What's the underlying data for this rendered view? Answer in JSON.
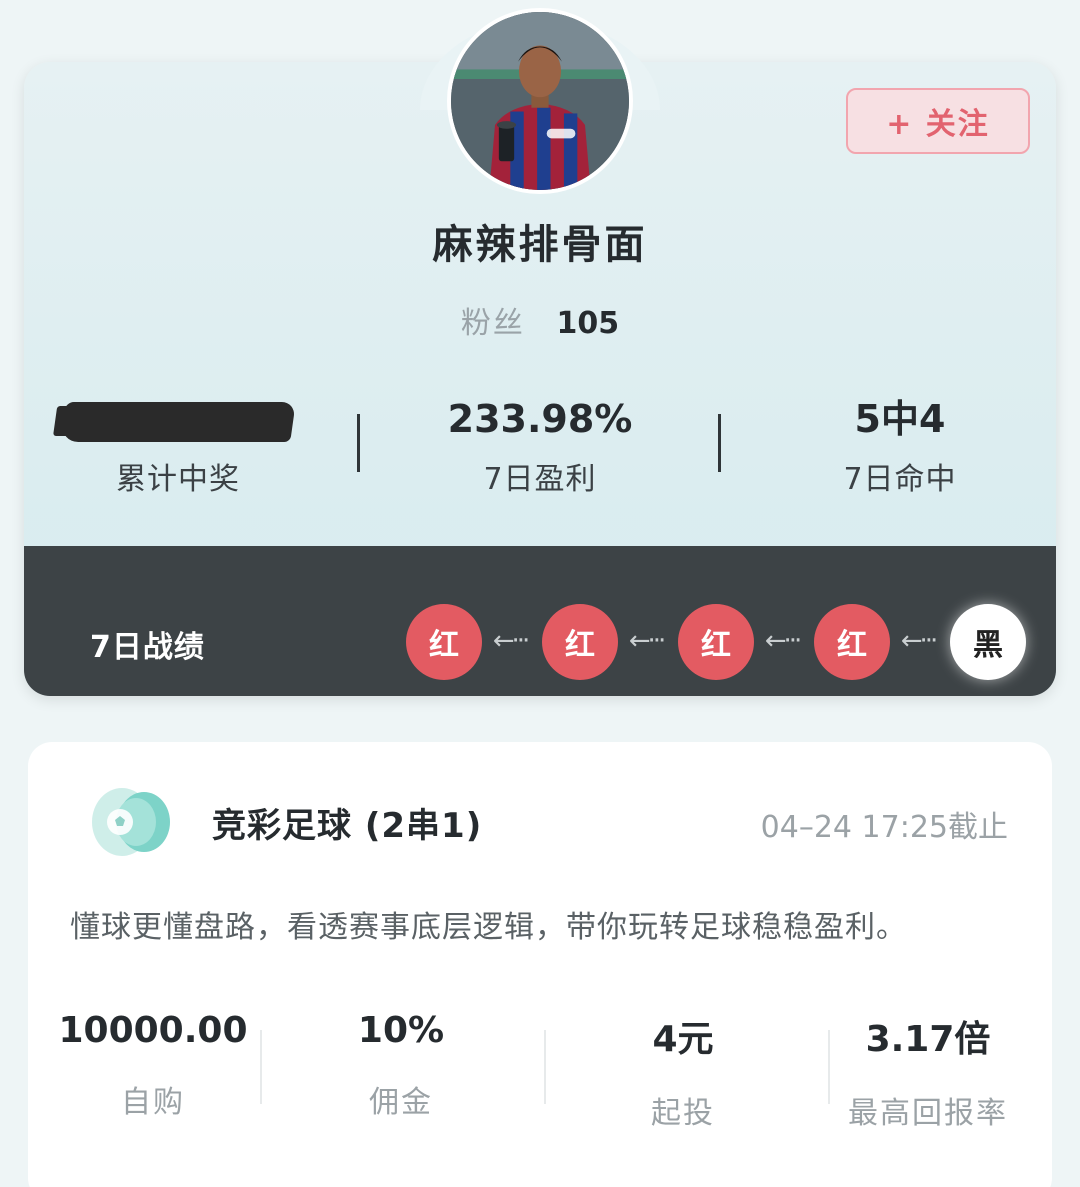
{
  "profile": {
    "name": "麻辣排骨面",
    "follow_label": "+ 关注",
    "fans_label": "粉丝",
    "fans_count": "105"
  },
  "stats": [
    {
      "value": "",
      "label": "累计中奖"
    },
    {
      "value": "233.98%",
      "label": "7日盈利"
    },
    {
      "value": "5中4",
      "label": "7日命中"
    }
  ],
  "record": {
    "label": "7日战绩",
    "results": [
      "红",
      "红",
      "红",
      "红",
      "黑"
    ],
    "arrow": "←···"
  },
  "plan": {
    "title": "竞彩足球 (2串1)",
    "deadline": "04–24 17:25截止",
    "description": "懂球更懂盘路，看透赛事底层逻辑，带你玩转足球稳稳盈利。",
    "metrics": [
      {
        "value": "10000.00",
        "label": "自购"
      },
      {
        "value": "10%",
        "label": "佣金"
      },
      {
        "value": "4元",
        "label": "起投"
      },
      {
        "value": "3.17倍",
        "label": "最高回报率"
      }
    ]
  },
  "icons": {
    "avatar": "player-avatar-image",
    "ball": "soccer-ball-icon"
  },
  "colors": {
    "accent_red": "#e35b62",
    "follow_text": "#e2636f",
    "record_bar": "#3d4346",
    "teal": "#4cc4b8"
  }
}
